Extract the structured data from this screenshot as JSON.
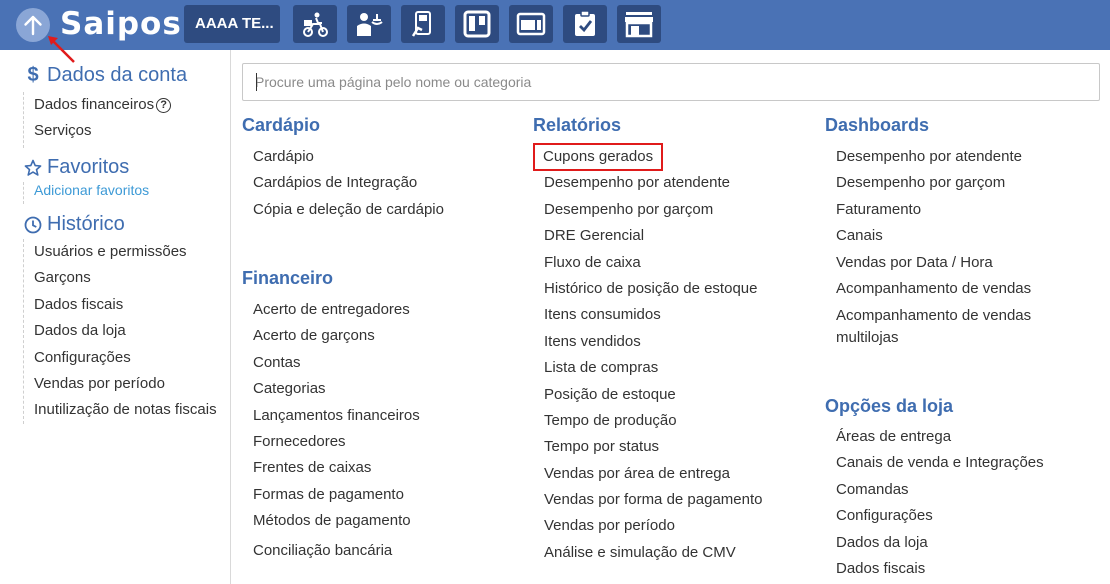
{
  "topbar": {
    "logo": "Saipos",
    "store_label": "AAAA TE...",
    "icons": [
      "delivery-icon",
      "waiter-icon",
      "mobile-order-icon",
      "trello-icon",
      "screen-icon",
      "clipboard-check-icon",
      "store-icon"
    ]
  },
  "sidebar": {
    "account": {
      "title": "Dados da conta",
      "items": [
        "Dados financeiros",
        "Serviços"
      ],
      "help": "?"
    },
    "favorites": {
      "title": "Favoritos",
      "add_link": "Adicionar favoritos"
    },
    "history": {
      "title": "Histórico",
      "items": [
        "Usuários e permissões",
        "Garçons",
        "Dados fiscais",
        "Dados da loja",
        "Configurações",
        "Vendas por período",
        "Inutilização de notas fiscais"
      ]
    }
  },
  "search": {
    "placeholder": "Procure uma página pelo nome ou categoria",
    "value": ""
  },
  "columns": {
    "cardapio": {
      "title": "Cardápio",
      "items": [
        "Cardápio",
        "Cardápios de Integração",
        "Cópia e deleção de cardápio"
      ]
    },
    "financeiro": {
      "title": "Financeiro",
      "items": [
        "Acerto de entregadores",
        "Acerto de garçons",
        "Contas",
        "Categorias",
        "Lançamentos financeiros",
        "Fornecedores",
        "Frentes de caixas",
        "Formas de pagamento",
        "Métodos de pagamento",
        "Conciliação bancária"
      ]
    },
    "relatorios": {
      "title": "Relatórios",
      "items": [
        "Cupons gerados",
        "Desempenho por atendente",
        "Desempenho por garçom",
        "DRE Gerencial",
        "Fluxo de caixa",
        "Histórico de posição de estoque",
        "Itens consumidos",
        "Itens vendidos",
        "Lista de compras",
        "Posição de estoque",
        "Tempo de produção",
        "Tempo por status",
        "Vendas por área de entrega",
        "Vendas por forma de pagamento",
        "Vendas por período",
        "Análise e simulação de CMV"
      ]
    },
    "dashboards": {
      "title": "Dashboards",
      "items": [
        "Desempenho por atendente",
        "Desempenho por garçom",
        "Faturamento",
        "Canais",
        "Vendas por Data / Hora",
        "Acompanhamento de vendas",
        "Acompanhamento de vendas multilojas"
      ]
    },
    "opcoes": {
      "title": "Opções da loja",
      "items": [
        "Áreas de entrega",
        "Canais de venda e Integrações",
        "Comandas",
        "Configurações",
        "Dados da loja",
        "Dados fiscais"
      ]
    }
  },
  "colors": {
    "topbar": "#4a72b5",
    "topbar_button": "#2e4b80",
    "accent_title": "#3f6db0",
    "link": "#3d9ad6",
    "highlight_border": "#e01b1b"
  }
}
